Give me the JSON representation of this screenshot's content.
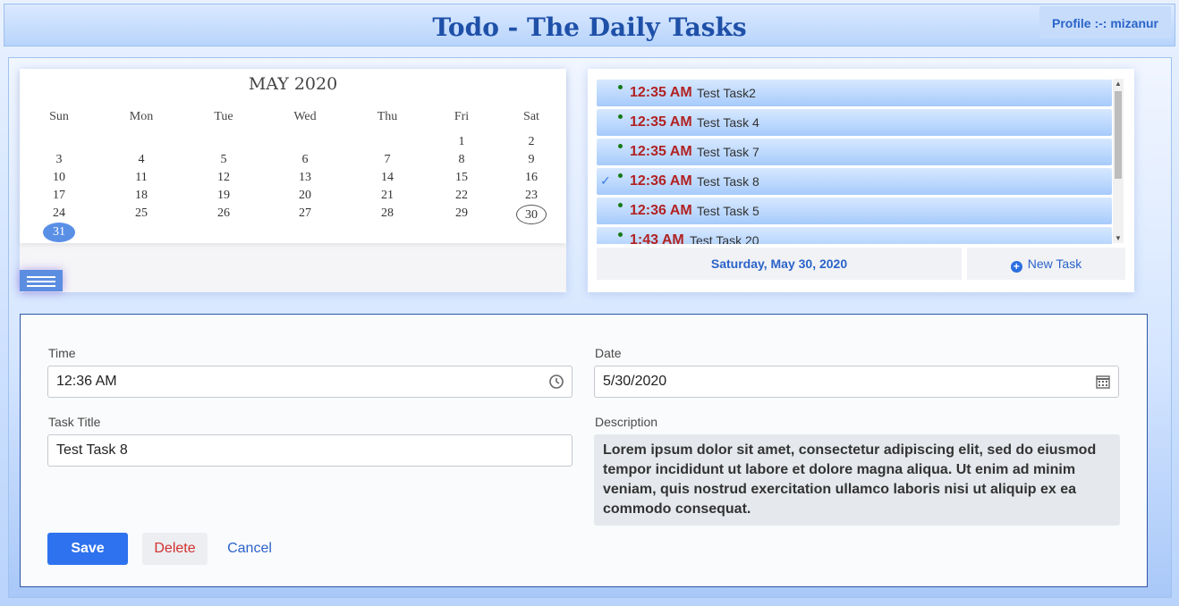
{
  "header": {
    "title": "Todo - The Daily Tasks",
    "profile": "Profile :-: mizanur"
  },
  "calendar": {
    "month_label": "MAY 2020",
    "weekdays": [
      "Sun",
      "Mon",
      "Tue",
      "Wed",
      "Thu",
      "Fri",
      "Sat"
    ],
    "weeks": [
      [
        "",
        "",
        "",
        "",
        "",
        "1",
        "2"
      ],
      [
        "3",
        "4",
        "5",
        "6",
        "7",
        "8",
        "9"
      ],
      [
        "10",
        "11",
        "12",
        "13",
        "14",
        "15",
        "16"
      ],
      [
        "17",
        "18",
        "19",
        "20",
        "21",
        "22",
        "23"
      ],
      [
        "24",
        "25",
        "26",
        "27",
        "28",
        "29",
        "30"
      ],
      [
        "31",
        "",
        "",
        "",
        "",
        "",
        ""
      ]
    ],
    "today": "30",
    "selected": "31"
  },
  "tasks": {
    "items": [
      {
        "time": "12:35 AM",
        "title": "Test Task2",
        "checked": false
      },
      {
        "time": "12:35 AM",
        "title": "Test Task 4",
        "checked": false
      },
      {
        "time": "12:35 AM",
        "title": "Test Task 7",
        "checked": false
      },
      {
        "time": "12:36 AM",
        "title": "Test Task 8",
        "checked": true
      },
      {
        "time": "12:36 AM",
        "title": "Test Task 5",
        "checked": false
      },
      {
        "time": "1:43 AM",
        "title": "Test Task 20",
        "checked": false
      }
    ],
    "selected_date": "Saturday, May 30, 2020",
    "new_task_label": "New Task"
  },
  "form": {
    "time_label": "Time",
    "time_value": "12:36 AM",
    "date_label": "Date",
    "date_value": "5/30/2020",
    "title_label": "Task Title",
    "title_value": "Test Task 8",
    "description_label": "Description",
    "description_value": "Lorem ipsum dolor sit amet, consectetur adipiscing elit, sed do eiusmod tempor incididunt ut labore et dolore magna aliqua. Ut enim ad minim veniam, quis nostrud exercitation ullamco laboris nisi ut aliquip ex ea commodo consequat.",
    "save_label": "Save",
    "delete_label": "Delete",
    "cancel_label": "Cancel"
  },
  "icons": {
    "clock": "clock-icon",
    "calendar": "calendar-icon",
    "plus": "plus-circle-icon",
    "menu": "hamburger-menu-icon",
    "check": "check-icon"
  },
  "colors": {
    "accent": "#2e72ef",
    "task_time": "#b22222",
    "title": "#1e50a8"
  }
}
